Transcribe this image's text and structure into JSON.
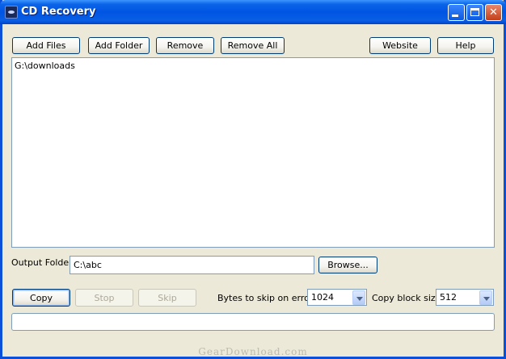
{
  "window": {
    "title": "CD Recovery"
  },
  "toolbar": {
    "add_files": "Add Files",
    "add_folder": "Add Folder",
    "remove": "Remove",
    "remove_all": "Remove All",
    "website": "Website",
    "help": "Help"
  },
  "source_list": {
    "items": [
      "G:\\downloads"
    ]
  },
  "output": {
    "label": "Output Folder",
    "value": "C:\\abc",
    "browse": "Browse..."
  },
  "actions": {
    "copy": "Copy",
    "stop": "Stop",
    "skip": "Skip"
  },
  "settings": {
    "bytes_skip_label": "Bytes to skip on error",
    "bytes_skip_value": "1024",
    "block_size_label": "Copy block size",
    "block_size_value": "512"
  },
  "progress": {
    "fraction": 0
  },
  "watermark": "GearDownload.com"
}
